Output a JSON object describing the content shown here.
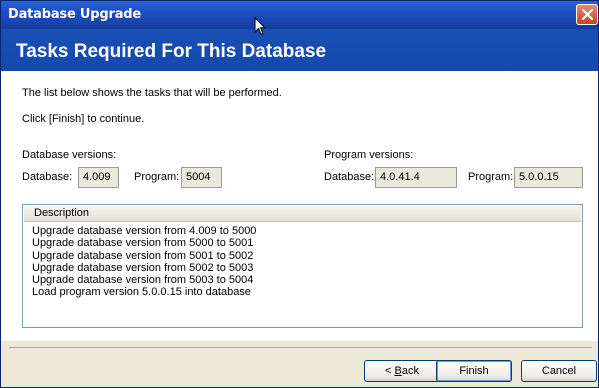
{
  "window": {
    "title": "Database Upgrade"
  },
  "header": {
    "title": "Tasks Required For This Database"
  },
  "intro": {
    "line1": "The list below shows the tasks that will be performed.",
    "line2": "Click [Finish] to continue."
  },
  "database_versions": {
    "label": "Database versions:",
    "database_label": "Database:",
    "database_value": "4.009",
    "program_label": "Program:",
    "program_value": "5004"
  },
  "program_versions": {
    "label": "Program versions:",
    "database_label": "Database:",
    "database_value": "4.0.41.4",
    "program_label": "Program:",
    "program_value": "5.0.0.15"
  },
  "tasks": {
    "column_header": "Description",
    "items": [
      "Upgrade database version from 4.009 to 5000",
      "Upgrade database version from 5000 to 5001",
      "Upgrade database version from 5001 to 5002",
      "Upgrade database version from 5002 to 5003",
      "Upgrade database version from 5003 to 5004",
      "Load program version 5.0.0.15 into database"
    ]
  },
  "buttons": {
    "back_prefix": "< ",
    "back_mnemonic": "B",
    "back_rest": "ack",
    "finish": "Finish",
    "cancel": "Cancel"
  },
  "colors": {
    "titlebar": "#1b4fc0",
    "header": "#1448ad",
    "close_button": "#c8441f"
  }
}
